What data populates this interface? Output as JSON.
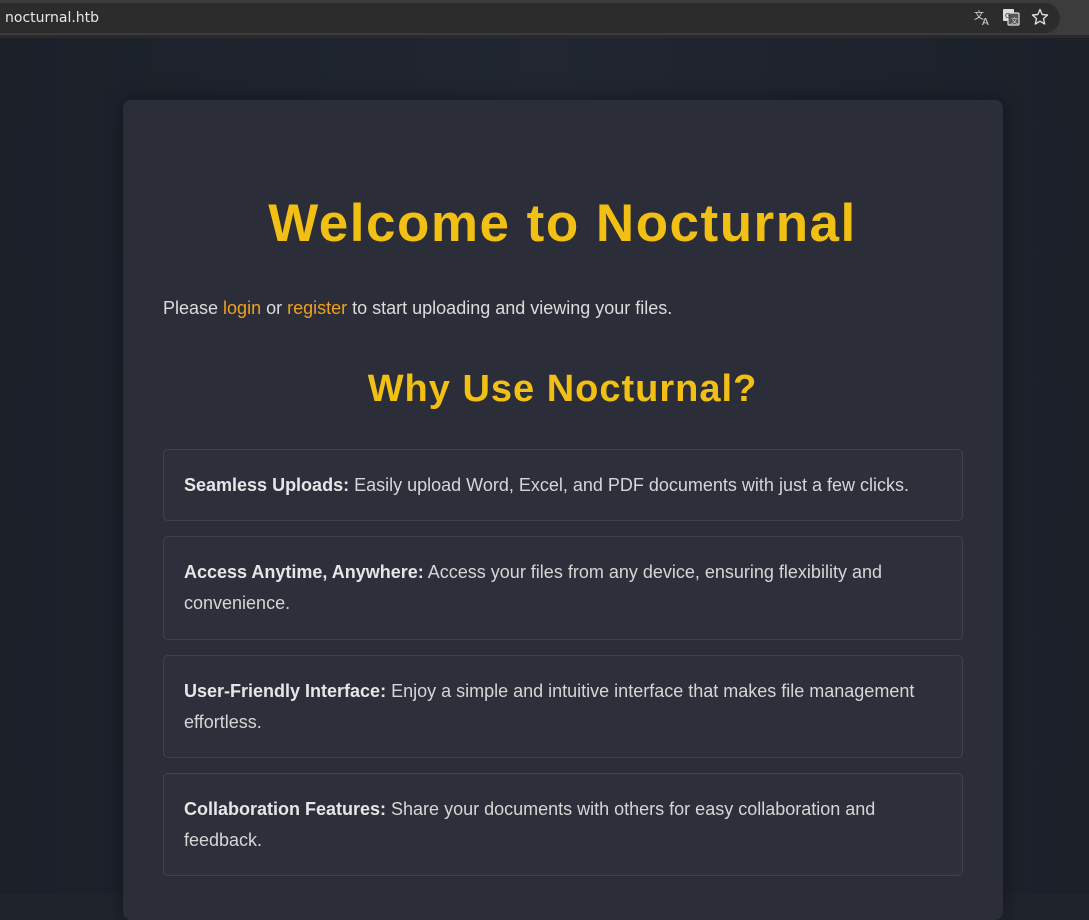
{
  "browser": {
    "url": "nocturnal.htb",
    "icons": [
      "translate-icon",
      "google-translate-icon",
      "bookmark-star-icon"
    ]
  },
  "colors": {
    "accent": "#f2c014",
    "link": "#f0a020",
    "card": "#2b2e38",
    "background": "#1f232b"
  },
  "page": {
    "title": "Welcome to Nocturnal",
    "intro": {
      "before": "Please ",
      "login": "login",
      "middle": " or ",
      "register": "register",
      "after": " to start uploading and viewing your files."
    },
    "why_title": "Why Use Nocturnal?",
    "features": [
      {
        "title": "Seamless Uploads:",
        "text": " Easily upload Word, Excel, and PDF documents with just a few clicks."
      },
      {
        "title": "Access Anytime, Anywhere:",
        "text": " Access your files from any device, ensuring flexibility and convenience."
      },
      {
        "title": "User-Friendly Interface:",
        "text": " Enjoy a simple and intuitive interface that makes file management effortless."
      },
      {
        "title": "Collaboration Features:",
        "text": " Share your documents with others for easy collaboration and feedback."
      }
    ]
  }
}
